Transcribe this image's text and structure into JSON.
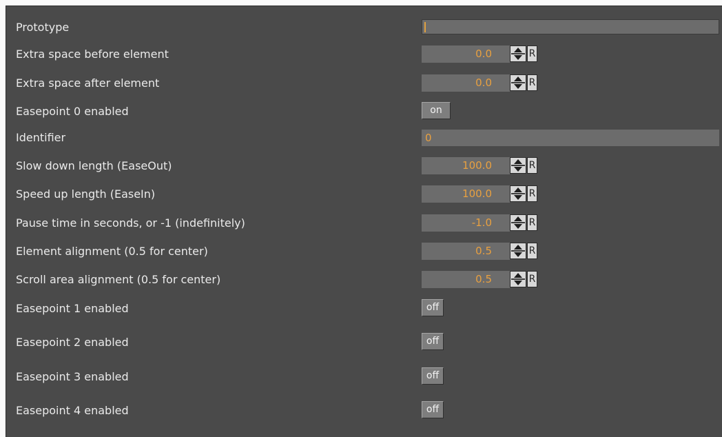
{
  "rows": {
    "prototype": {
      "label": "Prototype",
      "value": ""
    },
    "extra_before": {
      "label": "Extra space before element",
      "value": "0.0",
      "reset": "R"
    },
    "extra_after": {
      "label": "Extra space after element",
      "value": "0.0",
      "reset": "R"
    },
    "easepoint0": {
      "label": "Easepoint 0 enabled",
      "state": "on"
    },
    "identifier": {
      "label": "Identifier",
      "value": "0"
    },
    "slow_down": {
      "label": "Slow down length (EaseOut)",
      "value": "100.0",
      "reset": "R"
    },
    "speed_up": {
      "label": "Speed up length (EaseIn)",
      "value": "100.0",
      "reset": "R"
    },
    "pause_time": {
      "label": "Pause time in seconds, or -1 (indefinitely)",
      "value": "-1.0",
      "reset": "R"
    },
    "element_alignment": {
      "label": "Element alignment (0.5 for center)",
      "value": "0.5",
      "reset": "R"
    },
    "scroll_alignment": {
      "label": "Scroll area alignment (0.5 for center)",
      "value": "0.5",
      "reset": "R"
    },
    "easepoint1": {
      "label": "Easepoint 1 enabled",
      "state": "off"
    },
    "easepoint2": {
      "label": "Easepoint 2 enabled",
      "state": "off"
    },
    "easepoint3": {
      "label": "Easepoint 3 enabled",
      "state": "off"
    },
    "easepoint4": {
      "label": "Easepoint 4 enabled",
      "state": "off"
    }
  },
  "colors": {
    "panel_bg": "#4a4a4a",
    "field_bg": "#6c6c6c",
    "value_text": "#e8a040",
    "label_text": "#eaeaea"
  }
}
